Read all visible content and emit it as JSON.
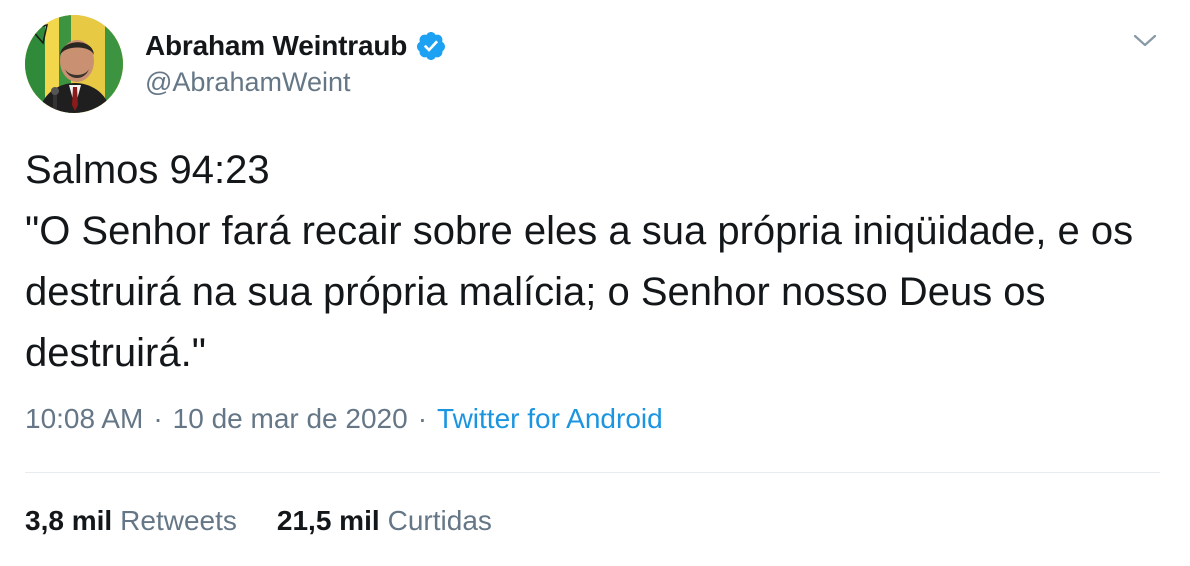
{
  "author": {
    "display_name": "Abraham Weintraub",
    "handle": "@AbrahamWeint",
    "verified_icon": "verified-badge-icon",
    "avatar_icon": "profile-avatar"
  },
  "tweet": {
    "text": "Salmos 94:23\n\"O Senhor fará recair sobre eles a sua própria iniqüidade, e os destruirá na sua própria malícia; o Senhor nosso Deus os destruirá.\""
  },
  "meta": {
    "time": "10:08 AM",
    "separator": "·",
    "date": "10 de mar de 2020",
    "source": "Twitter for Android"
  },
  "stats": {
    "retweets_count": "3,8 mil",
    "retweets_label": "Retweets",
    "likes_count": "21,5 mil",
    "likes_label": "Curtidas"
  },
  "colors": {
    "text": "#14171a",
    "secondary": "#657786",
    "link": "#1b95e0",
    "divider": "#e6ecf0",
    "verified": "#1da1f2"
  }
}
